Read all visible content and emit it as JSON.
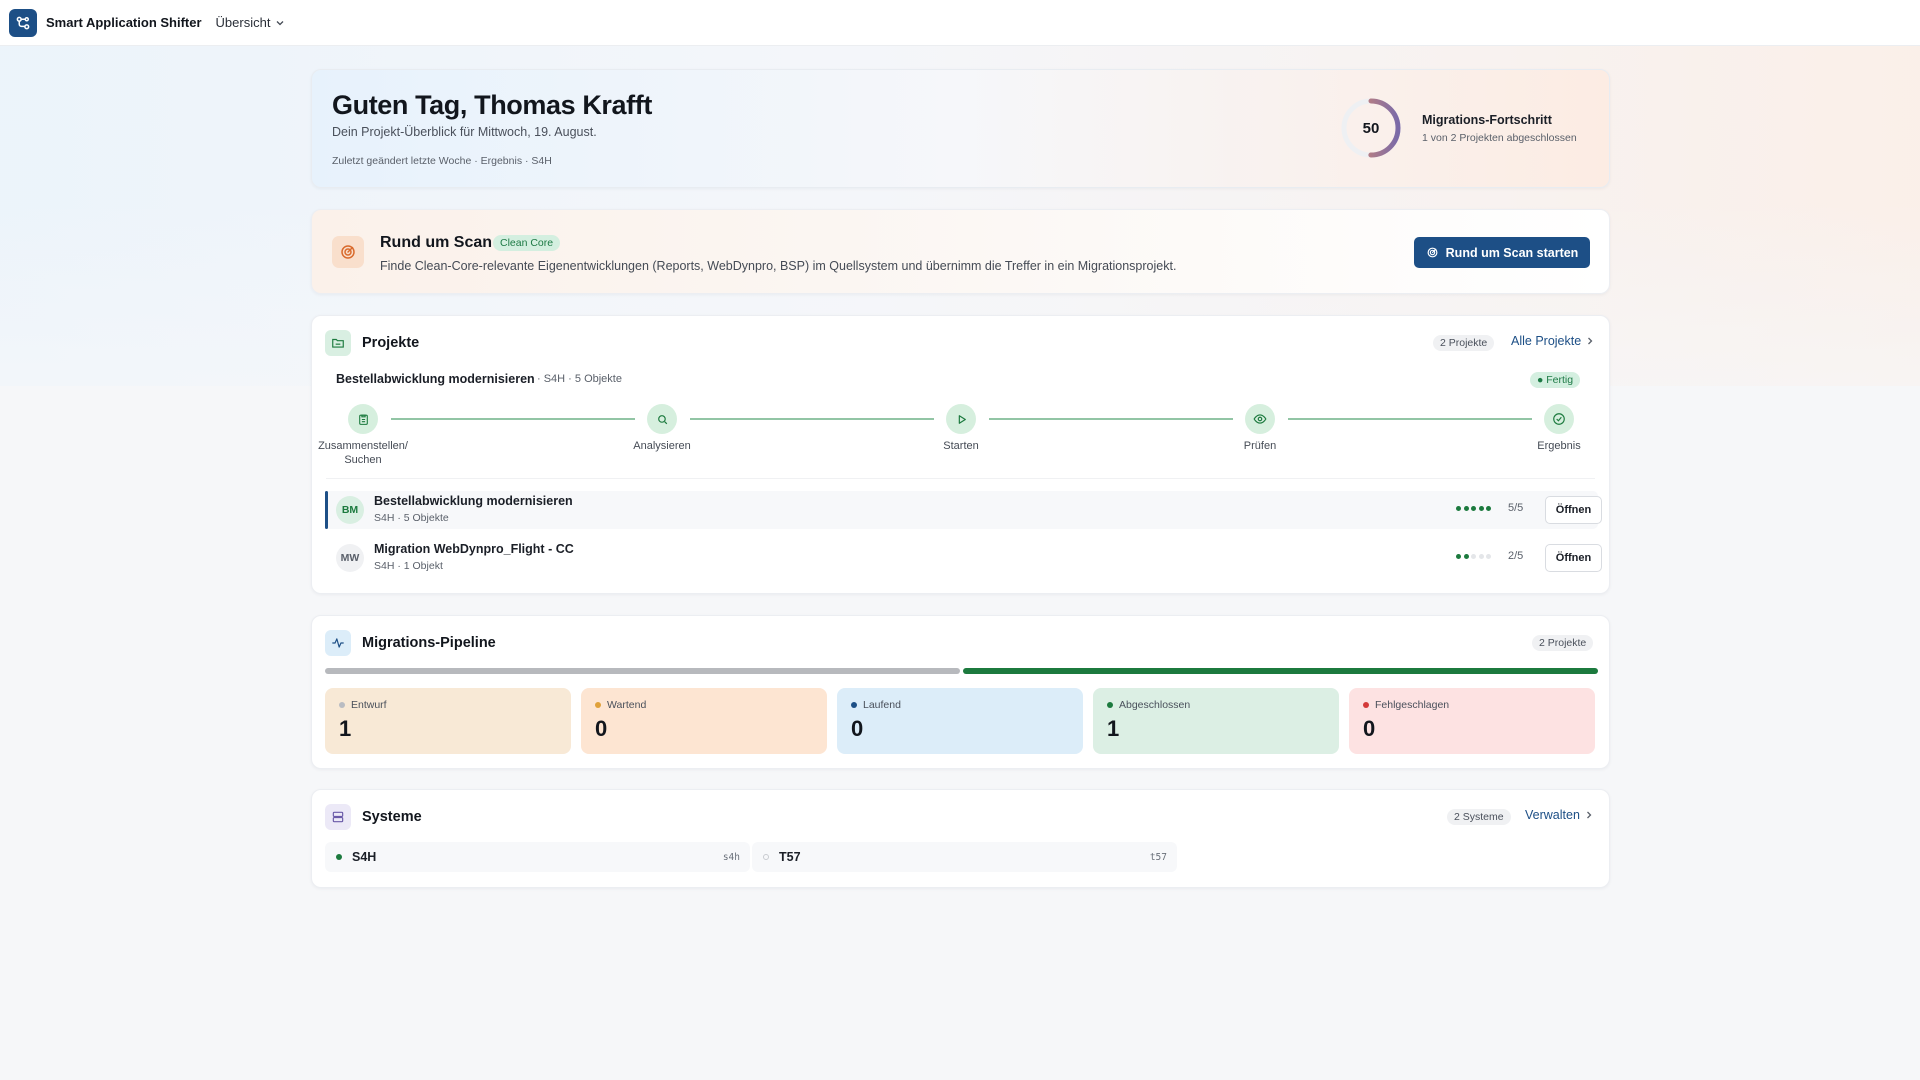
{
  "app": {
    "name": "Smart Application Shifter",
    "nav_label": "Übersicht"
  },
  "hero": {
    "greeting": "Guten Tag, Thomas Krafft",
    "subtitle": "Dein Projekt-Überblick für Mittwoch, 19. August.",
    "meta": "Zuletzt geändert letzte Woche · Ergebnis · S4H",
    "progress_value": "50",
    "progress_percent": 50,
    "progress_title": "Migrations-Fortschritt",
    "progress_sub": "1 von 2 Projekten abgeschlossen"
  },
  "scan": {
    "title": "Rund um Scan",
    "badge": "Clean Core",
    "description": "Finde Clean-Core-relevante Eigenentwicklungen (Reports, WebDynpro, BSP) im Quellsystem und übernimm die Treffer in ein Migrationsprojekt.",
    "button": "Rund um Scan starten"
  },
  "projects": {
    "title": "Projekte",
    "count": "2 Projekte",
    "link": "Alle Projekte",
    "current": {
      "name": "Bestellabwicklung modernisieren",
      "meta": "· S4H · 5 Objekte",
      "status": "● Fertig"
    },
    "steps": [
      {
        "label": "Zusammenstellen/ Suchen",
        "icon": "clipboard-icon"
      },
      {
        "label": "Analysieren",
        "icon": "search-icon"
      },
      {
        "label": "Starten",
        "icon": "play-icon"
      },
      {
        "label": "Prüfen",
        "icon": "eye-icon"
      },
      {
        "label": "Ergebnis",
        "icon": "check-circle-icon"
      }
    ],
    "rows": [
      {
        "initials": "BM",
        "title": "Bestellabwicklung modernisieren",
        "sub": "S4H · 5 Objekte",
        "progress": "5/5",
        "done": 5,
        "total": 5,
        "button": "Öffnen"
      },
      {
        "initials": "MW",
        "title": "Migration WebDynpro_Flight - CC",
        "sub": "S4H · 1 Objekt",
        "progress": "2/5",
        "done": 2,
        "total": 5,
        "button": "Öffnen"
      }
    ]
  },
  "pipeline": {
    "title": "Migrations-Pipeline",
    "count": "2 Projekte",
    "stats": [
      {
        "label": "Entwurf",
        "value": "1",
        "color": "#b9bcc2",
        "bg": "#f8e9d6"
      },
      {
        "label": "Wartend",
        "value": "0",
        "color": "#e0a13a",
        "bg": "#fde5d2"
      },
      {
        "label": "Laufend",
        "value": "0",
        "color": "#1d4f86",
        "bg": "#dcedf9"
      },
      {
        "label": "Abgeschlossen",
        "value": "1",
        "color": "#1c7a3e",
        "bg": "#dcefe4"
      },
      {
        "label": "Fehlgeschlagen",
        "value": "0",
        "color": "#d43a3a",
        "bg": "#fde2e2"
      }
    ]
  },
  "systems": {
    "title": "Systeme",
    "count": "2 Systeme",
    "link": "Verwalten",
    "items": [
      {
        "name": "S4H",
        "code": "s4h",
        "status_color": "#1c7a3e"
      },
      {
        "name": "T57",
        "code": "t57",
        "status_color": "#c8cbd0"
      }
    ]
  },
  "colors": {
    "brand": "#1d4f86",
    "success": "#1c7a3e",
    "progress_ring": "#d98a6a"
  }
}
